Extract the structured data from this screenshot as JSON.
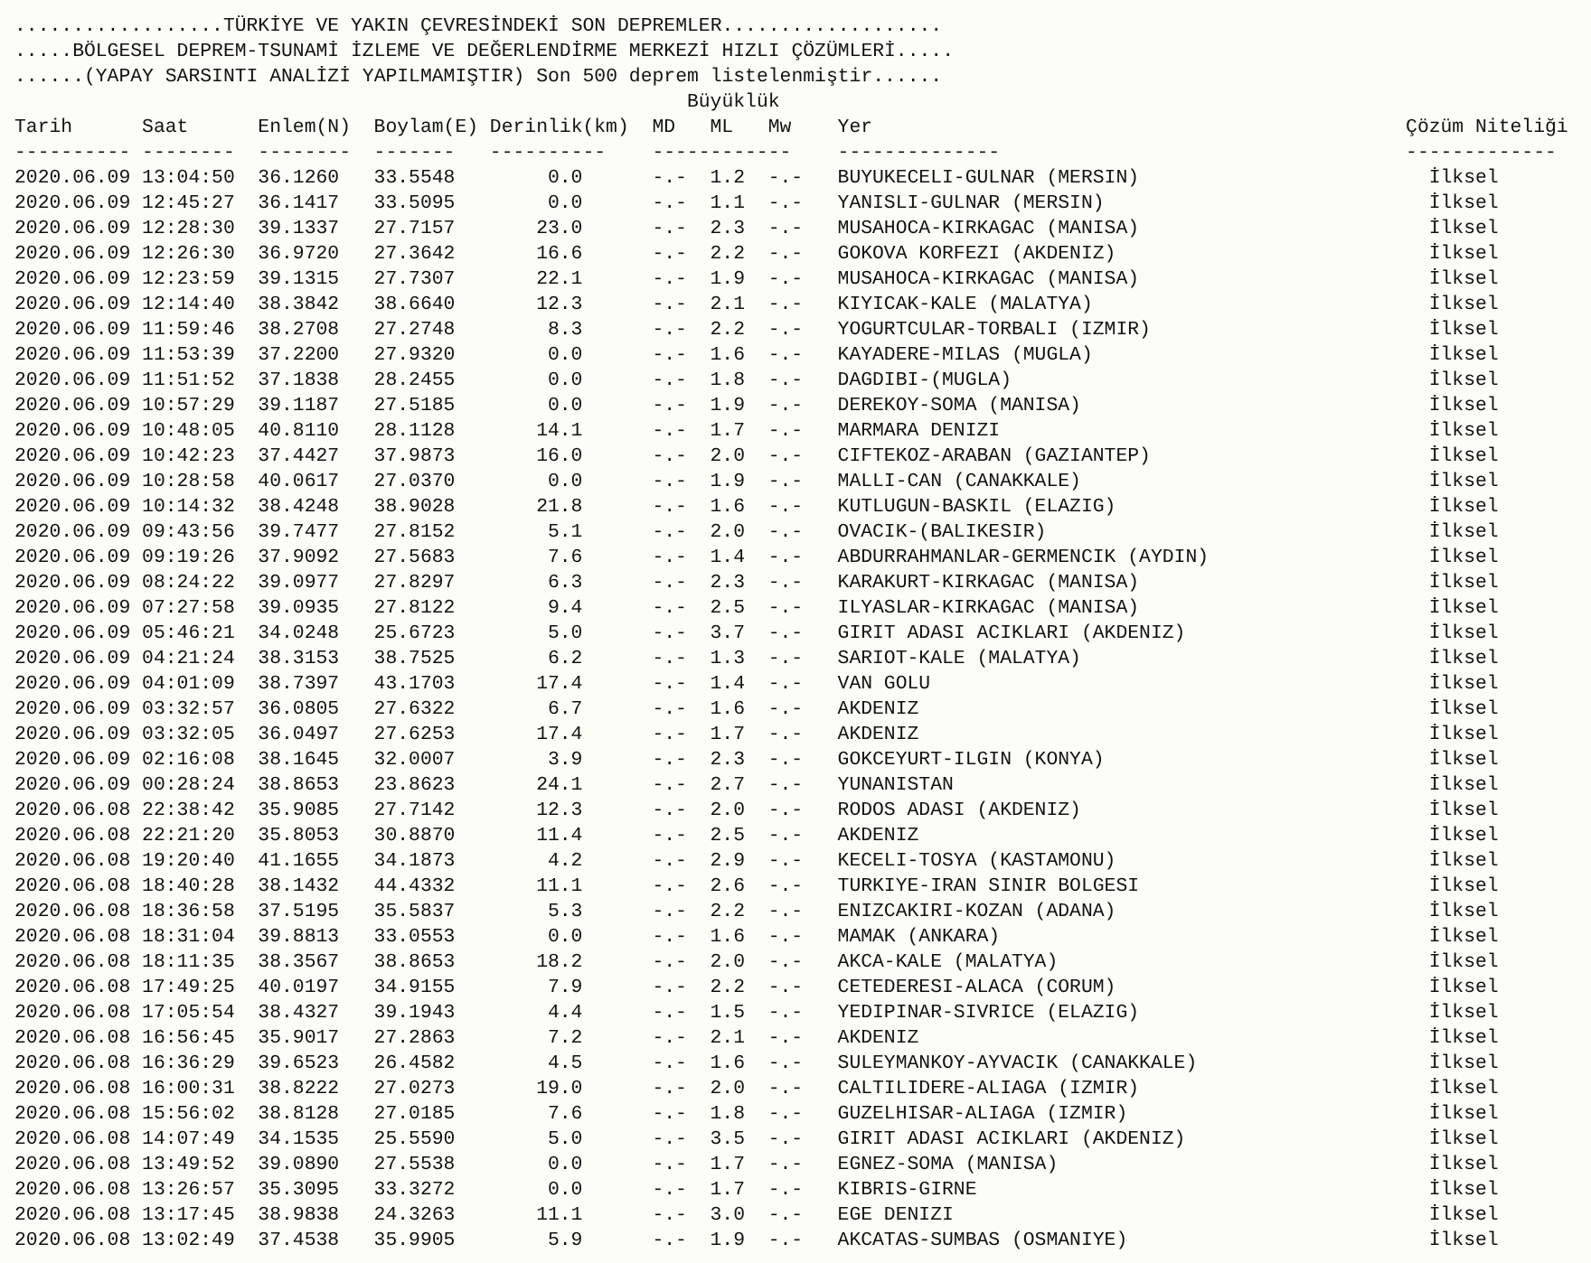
{
  "title_lines": [
    "..................TÜRKİYE VE YAKIN ÇEVRESİNDEKİ SON DEPREMLER...................",
    ".....BÖLGESEL DEPREM-TSUNAMİ İZLEME VE DEĞERLENDİRME MERKEZİ HIZLI ÇÖZÜMLERİ.....",
    "......(YAPAY SARSINTI ANALİZİ YAPILMAMIŞTIR) Son 500 deprem listelenmiştir......"
  ],
  "magnitude_group": "Büyüklük",
  "columns": [
    "Tarih",
    "Saat",
    "Enlem(N)",
    "Boylam(E)",
    "Derinlik(km)",
    "MD",
    "ML",
    "Mw",
    "Yer",
    "Çözüm Niteliği"
  ],
  "header_rules": [
    "----------",
    "--------",
    "--------",
    "-------",
    "----------",
    "------------",
    "--------------",
    "-------------"
  ],
  "rows": [
    {
      "date": "2020.06.09",
      "time": "13:04:50",
      "latitude": "36.1260",
      "longitude": "33.5548",
      "depth_km": "0.0",
      "md": "-.-",
      "ml": "1.2",
      "mw": "-.-",
      "location": "BUYUKECELI-GULNAR (MERSIN)",
      "solution": "İlksel"
    },
    {
      "date": "2020.06.09",
      "time": "12:45:27",
      "latitude": "36.1417",
      "longitude": "33.5095",
      "depth_km": "0.0",
      "md": "-.-",
      "ml": "1.1",
      "mw": "-.-",
      "location": "YANISLI-GULNAR (MERSIN)",
      "solution": "İlksel"
    },
    {
      "date": "2020.06.09",
      "time": "12:28:30",
      "latitude": "39.1337",
      "longitude": "27.7157",
      "depth_km": "23.0",
      "md": "-.-",
      "ml": "2.3",
      "mw": "-.-",
      "location": "MUSAHOCA-KIRKAGAC (MANISA)",
      "solution": "İlksel"
    },
    {
      "date": "2020.06.09",
      "time": "12:26:30",
      "latitude": "36.9720",
      "longitude": "27.3642",
      "depth_km": "16.6",
      "md": "-.-",
      "ml": "2.2",
      "mw": "-.-",
      "location": "GOKOVA KORFEZI (AKDENIZ)",
      "solution": "İlksel"
    },
    {
      "date": "2020.06.09",
      "time": "12:23:59",
      "latitude": "39.1315",
      "longitude": "27.7307",
      "depth_km": "22.1",
      "md": "-.-",
      "ml": "1.9",
      "mw": "-.-",
      "location": "MUSAHOCA-KIRKAGAC (MANISA)",
      "solution": "İlksel"
    },
    {
      "date": "2020.06.09",
      "time": "12:14:40",
      "latitude": "38.3842",
      "longitude": "38.6640",
      "depth_km": "12.3",
      "md": "-.-",
      "ml": "2.1",
      "mw": "-.-",
      "location": "KIYICAK-KALE (MALATYA)",
      "solution": "İlksel"
    },
    {
      "date": "2020.06.09",
      "time": "11:59:46",
      "latitude": "38.2708",
      "longitude": "27.2748",
      "depth_km": "8.3",
      "md": "-.-",
      "ml": "2.2",
      "mw": "-.-",
      "location": "YOGURTCULAR-TORBALI (IZMIR)",
      "solution": "İlksel"
    },
    {
      "date": "2020.06.09",
      "time": "11:53:39",
      "latitude": "37.2200",
      "longitude": "27.9320",
      "depth_km": "0.0",
      "md": "-.-",
      "ml": "1.6",
      "mw": "-.-",
      "location": "KAYADERE-MILAS (MUGLA)",
      "solution": "İlksel"
    },
    {
      "date": "2020.06.09",
      "time": "11:51:52",
      "latitude": "37.1838",
      "longitude": "28.2455",
      "depth_km": "0.0",
      "md": "-.-",
      "ml": "1.8",
      "mw": "-.-",
      "location": "DAGDIBI-(MUGLA)",
      "solution": "İlksel"
    },
    {
      "date": "2020.06.09",
      "time": "10:57:29",
      "latitude": "39.1187",
      "longitude": "27.5185",
      "depth_km": "0.0",
      "md": "-.-",
      "ml": "1.9",
      "mw": "-.-",
      "location": "DEREKOY-SOMA (MANISA)",
      "solution": "İlksel"
    },
    {
      "date": "2020.06.09",
      "time": "10:48:05",
      "latitude": "40.8110",
      "longitude": "28.1128",
      "depth_km": "14.1",
      "md": "-.-",
      "ml": "1.7",
      "mw": "-.-",
      "location": "MARMARA DENIZI",
      "solution": "İlksel"
    },
    {
      "date": "2020.06.09",
      "time": "10:42:23",
      "latitude": "37.4427",
      "longitude": "37.9873",
      "depth_km": "16.0",
      "md": "-.-",
      "ml": "2.0",
      "mw": "-.-",
      "location": "CIFTEKOZ-ARABAN (GAZIANTEP)",
      "solution": "İlksel"
    },
    {
      "date": "2020.06.09",
      "time": "10:28:58",
      "latitude": "40.0617",
      "longitude": "27.0370",
      "depth_km": "0.0",
      "md": "-.-",
      "ml": "1.9",
      "mw": "-.-",
      "location": "MALLI-CAN (CANAKKALE)",
      "solution": "İlksel"
    },
    {
      "date": "2020.06.09",
      "time": "10:14:32",
      "latitude": "38.4248",
      "longitude": "38.9028",
      "depth_km": "21.8",
      "md": "-.-",
      "ml": "1.6",
      "mw": "-.-",
      "location": "KUTLUGUN-BASKIL (ELAZIG)",
      "solution": "İlksel"
    },
    {
      "date": "2020.06.09",
      "time": "09:43:56",
      "latitude": "39.7477",
      "longitude": "27.8152",
      "depth_km": "5.1",
      "md": "-.-",
      "ml": "2.0",
      "mw": "-.-",
      "location": "OVACIK-(BALIKESIR)",
      "solution": "İlksel"
    },
    {
      "date": "2020.06.09",
      "time": "09:19:26",
      "latitude": "37.9092",
      "longitude": "27.5683",
      "depth_km": "7.6",
      "md": "-.-",
      "ml": "1.4",
      "mw": "-.-",
      "location": "ABDURRAHMANLAR-GERMENCIK (AYDIN)",
      "solution": "İlksel"
    },
    {
      "date": "2020.06.09",
      "time": "08:24:22",
      "latitude": "39.0977",
      "longitude": "27.8297",
      "depth_km": "6.3",
      "md": "-.-",
      "ml": "2.3",
      "mw": "-.-",
      "location": "KARAKURT-KIRKAGAC (MANISA)",
      "solution": "İlksel"
    },
    {
      "date": "2020.06.09",
      "time": "07:27:58",
      "latitude": "39.0935",
      "longitude": "27.8122",
      "depth_km": "9.4",
      "md": "-.-",
      "ml": "2.5",
      "mw": "-.-",
      "location": "ILYASLAR-KIRKAGAC (MANISA)",
      "solution": "İlksel"
    },
    {
      "date": "2020.06.09",
      "time": "05:46:21",
      "latitude": "34.0248",
      "longitude": "25.6723",
      "depth_km": "5.0",
      "md": "-.-",
      "ml": "3.7",
      "mw": "-.-",
      "location": "GIRIT ADASI ACIKLARI (AKDENIZ)",
      "solution": "İlksel"
    },
    {
      "date": "2020.06.09",
      "time": "04:21:24",
      "latitude": "38.3153",
      "longitude": "38.7525",
      "depth_km": "6.2",
      "md": "-.-",
      "ml": "1.3",
      "mw": "-.-",
      "location": "SARIOT-KALE (MALATYA)",
      "solution": "İlksel"
    },
    {
      "date": "2020.06.09",
      "time": "04:01:09",
      "latitude": "38.7397",
      "longitude": "43.1703",
      "depth_km": "17.4",
      "md": "-.-",
      "ml": "1.4",
      "mw": "-.-",
      "location": "VAN GOLU",
      "solution": "İlksel"
    },
    {
      "date": "2020.06.09",
      "time": "03:32:57",
      "latitude": "36.0805",
      "longitude": "27.6322",
      "depth_km": "6.7",
      "md": "-.-",
      "ml": "1.6",
      "mw": "-.-",
      "location": "AKDENIZ",
      "solution": "İlksel"
    },
    {
      "date": "2020.06.09",
      "time": "03:32:05",
      "latitude": "36.0497",
      "longitude": "27.6253",
      "depth_km": "17.4",
      "md": "-.-",
      "ml": "1.7",
      "mw": "-.-",
      "location": "AKDENIZ",
      "solution": "İlksel"
    },
    {
      "date": "2020.06.09",
      "time": "02:16:08",
      "latitude": "38.1645",
      "longitude": "32.0007",
      "depth_km": "3.9",
      "md": "-.-",
      "ml": "2.3",
      "mw": "-.-",
      "location": "GOKCEYURT-ILGIN (KONYA)",
      "solution": "İlksel"
    },
    {
      "date": "2020.06.09",
      "time": "00:28:24",
      "latitude": "38.8653",
      "longitude": "23.8623",
      "depth_km": "24.1",
      "md": "-.-",
      "ml": "2.7",
      "mw": "-.-",
      "location": "YUNANISTAN",
      "solution": "İlksel"
    },
    {
      "date": "2020.06.08",
      "time": "22:38:42",
      "latitude": "35.9085",
      "longitude": "27.7142",
      "depth_km": "12.3",
      "md": "-.-",
      "ml": "2.0",
      "mw": "-.-",
      "location": "RODOS ADASI (AKDENIZ)",
      "solution": "İlksel"
    },
    {
      "date": "2020.06.08",
      "time": "22:21:20",
      "latitude": "35.8053",
      "longitude": "30.8870",
      "depth_km": "11.4",
      "md": "-.-",
      "ml": "2.5",
      "mw": "-.-",
      "location": "AKDENIZ",
      "solution": "İlksel"
    },
    {
      "date": "2020.06.08",
      "time": "19:20:40",
      "latitude": "41.1655",
      "longitude": "34.1873",
      "depth_km": "4.2",
      "md": "-.-",
      "ml": "2.9",
      "mw": "-.-",
      "location": "KECELI-TOSYA (KASTAMONU)",
      "solution": "İlksel"
    },
    {
      "date": "2020.06.08",
      "time": "18:40:28",
      "latitude": "38.1432",
      "longitude": "44.4332",
      "depth_km": "11.1",
      "md": "-.-",
      "ml": "2.6",
      "mw": "-.-",
      "location": "TURKIYE-IRAN SINIR BOLGESI",
      "solution": "İlksel"
    },
    {
      "date": "2020.06.08",
      "time": "18:36:58",
      "latitude": "37.5195",
      "longitude": "35.5837",
      "depth_km": "5.3",
      "md": "-.-",
      "ml": "2.2",
      "mw": "-.-",
      "location": "ENIZCAKIRI-KOZAN (ADANA)",
      "solution": "İlksel"
    },
    {
      "date": "2020.06.08",
      "time": "18:31:04",
      "latitude": "39.8813",
      "longitude": "33.0553",
      "depth_km": "0.0",
      "md": "-.-",
      "ml": "1.6",
      "mw": "-.-",
      "location": "MAMAK (ANKARA)",
      "solution": "İlksel"
    },
    {
      "date": "2020.06.08",
      "time": "18:11:35",
      "latitude": "38.3567",
      "longitude": "38.8653",
      "depth_km": "18.2",
      "md": "-.-",
      "ml": "2.0",
      "mw": "-.-",
      "location": "AKCA-KALE (MALATYA)",
      "solution": "İlksel"
    },
    {
      "date": "2020.06.08",
      "time": "17:49:25",
      "latitude": "40.0197",
      "longitude": "34.9155",
      "depth_km": "7.9",
      "md": "-.-",
      "ml": "2.2",
      "mw": "-.-",
      "location": "CETEDERESI-ALACA (CORUM)",
      "solution": "İlksel"
    },
    {
      "date": "2020.06.08",
      "time": "17:05:54",
      "latitude": "38.4327",
      "longitude": "39.1943",
      "depth_km": "4.4",
      "md": "-.-",
      "ml": "1.5",
      "mw": "-.-",
      "location": "YEDIPINAR-SIVRICE (ELAZIG)",
      "solution": "İlksel"
    },
    {
      "date": "2020.06.08",
      "time": "16:56:45",
      "latitude": "35.9017",
      "longitude": "27.2863",
      "depth_km": "7.2",
      "md": "-.-",
      "ml": "2.1",
      "mw": "-.-",
      "location": "AKDENIZ",
      "solution": "İlksel"
    },
    {
      "date": "2020.06.08",
      "time": "16:36:29",
      "latitude": "39.6523",
      "longitude": "26.4582",
      "depth_km": "4.5",
      "md": "-.-",
      "ml": "1.6",
      "mw": "-.-",
      "location": "SULEYMANKOY-AYVACIK (CANAKKALE)",
      "solution": "İlksel"
    },
    {
      "date": "2020.06.08",
      "time": "16:00:31",
      "latitude": "38.8222",
      "longitude": "27.0273",
      "depth_km": "19.0",
      "md": "-.-",
      "ml": "2.0",
      "mw": "-.-",
      "location": "CALTILIDERE-ALIAGA (IZMIR)",
      "solution": "İlksel"
    },
    {
      "date": "2020.06.08",
      "time": "15:56:02",
      "latitude": "38.8128",
      "longitude": "27.0185",
      "depth_km": "7.6",
      "md": "-.-",
      "ml": "1.8",
      "mw": "-.-",
      "location": "GUZELHISAR-ALIAGA (IZMIR)",
      "solution": "İlksel"
    },
    {
      "date": "2020.06.08",
      "time": "14:07:49",
      "latitude": "34.1535",
      "longitude": "25.5590",
      "depth_km": "5.0",
      "md": "-.-",
      "ml": "3.5",
      "mw": "-.-",
      "location": "GIRIT ADASI ACIKLARI (AKDENIZ)",
      "solution": "İlksel"
    },
    {
      "date": "2020.06.08",
      "time": "13:49:52",
      "latitude": "39.0890",
      "longitude": "27.5538",
      "depth_km": "0.0",
      "md": "-.-",
      "ml": "1.7",
      "mw": "-.-",
      "location": "EGNEZ-SOMA (MANISA)",
      "solution": "İlksel"
    },
    {
      "date": "2020.06.08",
      "time": "13:26:57",
      "latitude": "35.3095",
      "longitude": "33.3272",
      "depth_km": "0.0",
      "md": "-.-",
      "ml": "1.7",
      "mw": "-.-",
      "location": "KIBRIS-GIRNE",
      "solution": "İlksel"
    },
    {
      "date": "2020.06.08",
      "time": "13:17:45",
      "latitude": "38.9838",
      "longitude": "24.3263",
      "depth_km": "11.1",
      "md": "-.-",
      "ml": "3.0",
      "mw": "-.-",
      "location": "EGE DENIZI",
      "solution": "İlksel"
    },
    {
      "date": "2020.06.08",
      "time": "13:02:49",
      "latitude": "37.4538",
      "longitude": "35.9905",
      "depth_km": "5.9",
      "md": "-.-",
      "ml": "1.9",
      "mw": "-.-",
      "location": "AKCATAS-SUMBAS (OSMANIYE)",
      "solution": "İlksel"
    }
  ]
}
